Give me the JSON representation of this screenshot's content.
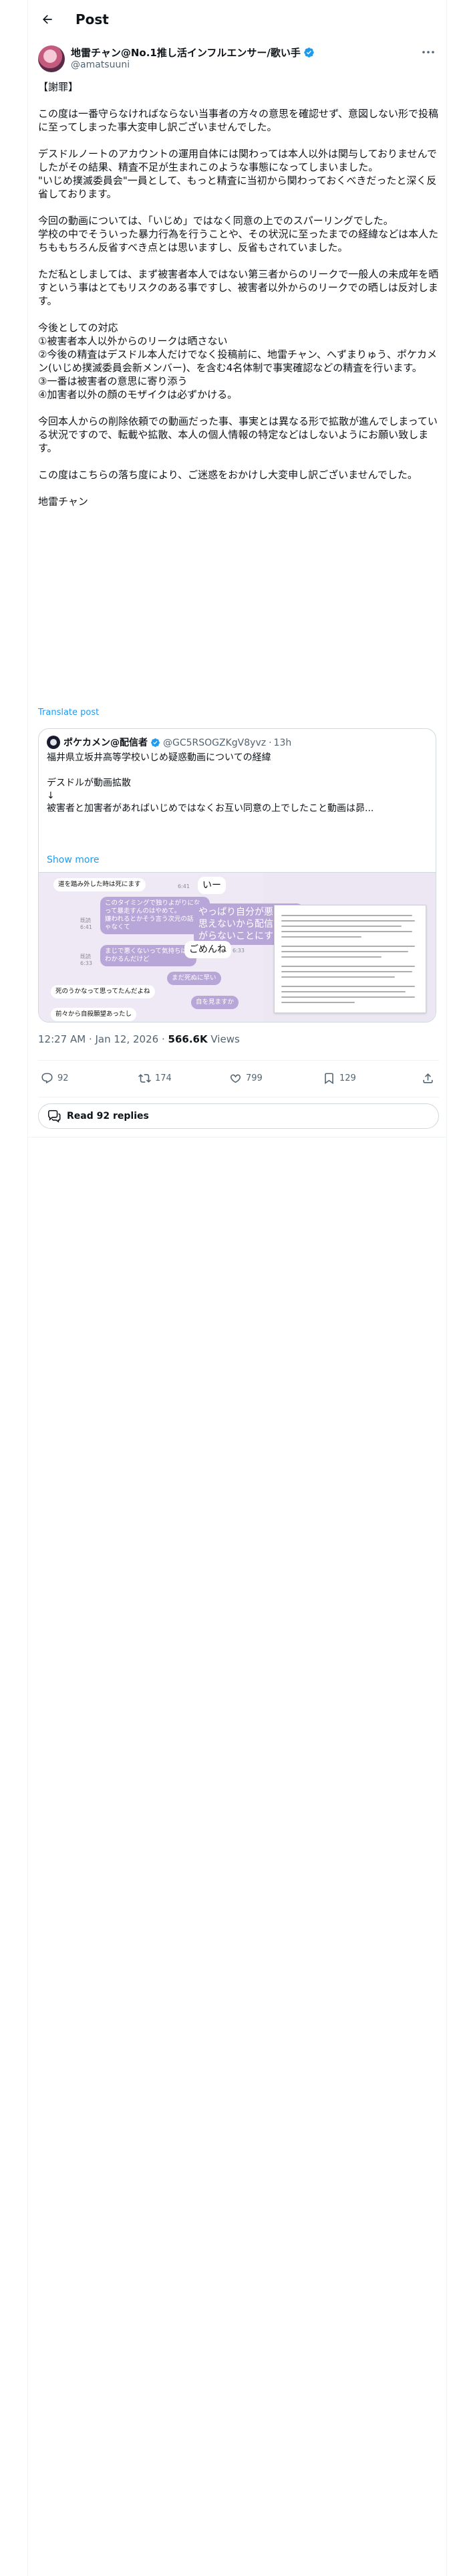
{
  "header": {
    "title": "Post"
  },
  "author": {
    "name": "地雷チャン@No.1推し活インフルエンサー/歌い手",
    "handle": "@amatsuuni"
  },
  "post": {
    "text": "【謝罪】\n\nこの度は一番守らなければならない当事者の方々の意思を確認せず、意図しない形で投稿に至ってしまった事大変申し訳ございませんでした。\n\nデスドルノートのアカウントの運用自体には関わっては本人以外は関与しておりませんでしたがその結果、精査不足が生まれこのような事態になってしまいました。\n\"いじめ撲滅委員会\"一員として、もっと精査に当初から関わっておくべきだったと深く反省しております。\n\n今回の動画については、「いじめ」ではなく同意の上でのスパーリングでした。\n学校の中でそういった暴力行為を行うことや、その状況に至ったまでの経緯などは本人たちももちろん反省すべき点とは思いますし、反省もされていました。\n\nただ私としましては、まず被害者本人ではない第三者からのリークで一般人の未成年を晒すという事はとてもリスクのある事ですし、被害者以外からのリークでの晒しは反対します。\n\n今後としての対応\n①被害者本人以外からのリークは晒さない\n②今後の精査はデスドル本人だけでなく投稿前に、地雷チャン、へずまりゅう、ポケカメン(いじめ撲滅委員会新メンバー)、を含む4名体制で事実確認などの精査を行います。\n③一番は被害者の意思に寄り添う\n④加害者以外の顔のモザイクは必ずかける。\n\n今回本人からの削除依頼での動画だった事、事実とは異なる形で拡散が進んでしまっている状況ですので、転載や拡散、本人の個人情報の特定などはしないようにお願い致します。\n\nこの度はこちらの落ち度により、ご迷惑をおかけし大変申し訳ございませんでした。\n\n地雷チャン",
    "translate": "Translate post"
  },
  "quote": {
    "name": "ポケカメン@配信者",
    "handle": "@GC5RSOGZKgV8yvz",
    "time": "13h",
    "text": "福井県立坂井高等学校いじめ疑惑動画についての経緯\n\nデスドルが動画拡散\n↓\n被害者と加害者があればいじめではなくお互い同意の上でしたこと動画は昴...",
    "show_more": "Show more",
    "chat": {
      "m1": "道を踏み外した時は死にます",
      "m2": "このタイミングで独りよがりになって暴走すんのはやめて。\n嫌われるとかそう言う次元の話じゃなくて",
      "m3": "やっぱり自分が悪いと思えないから配信に上がらないことにするよ",
      "m4": "まじで悪くないって気持ちはわかるんだけど",
      "m5": "ごめんね",
      "m6": "まだ死ぬに早い",
      "m7": "死のうかなって思ってたんだよね",
      "m8": "自を見ますか",
      "m9": "前々から自殺願望あったし",
      "t1": "6:41",
      "t2": "既読\n6:41",
      "t3": "6:33",
      "t4": "既読\n6:33"
    }
  },
  "meta": {
    "time": "12:27 AM · Jan 12, 2026",
    "views": "566.6K",
    "views_label": "Views"
  },
  "actions": {
    "replies": "92",
    "reposts": "174",
    "likes": "799",
    "bookmarks": "129"
  },
  "read_replies": "Read 92 replies",
  "colors": {
    "accent": "#1d9bf0",
    "text": "#0f1419",
    "secondary": "#536471"
  }
}
